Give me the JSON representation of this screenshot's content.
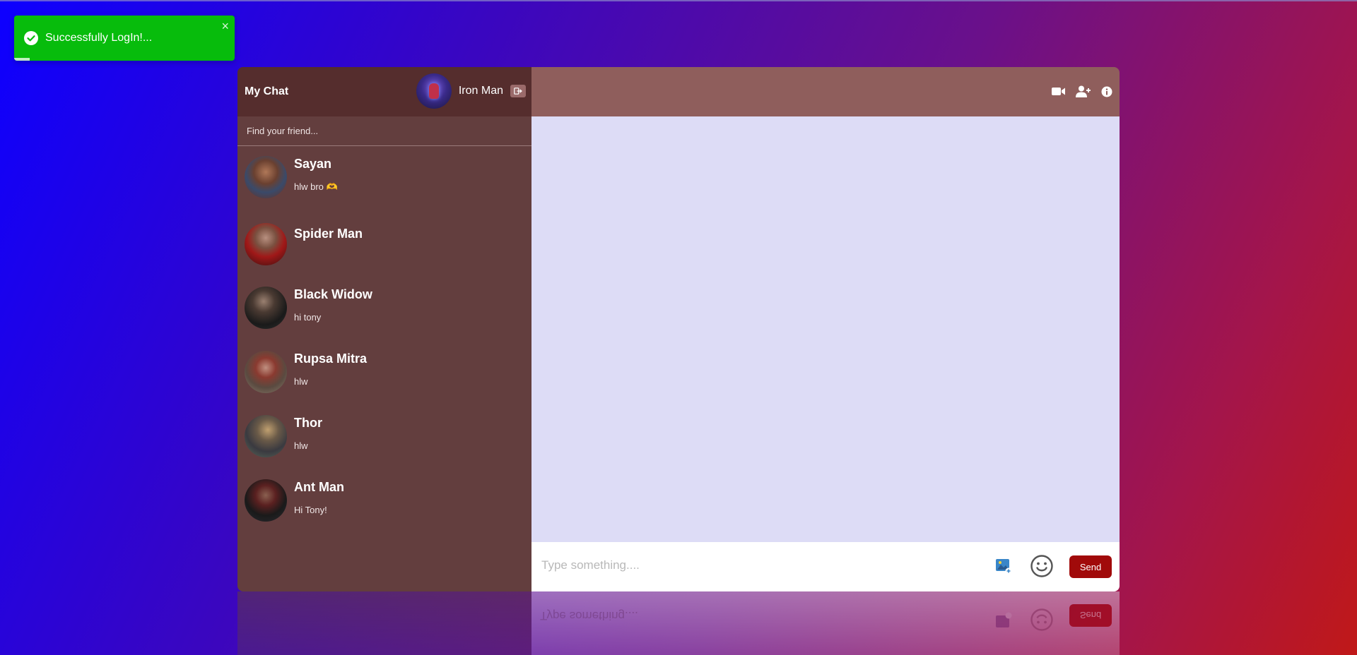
{
  "toast": {
    "message": "Successfully LogIn!...",
    "close_glyph": "×",
    "progress_percent": 7
  },
  "sidebar": {
    "brand": "My Chat",
    "current_user": {
      "name": "Iron Man",
      "avatar_icon": "iron-man-avatar"
    },
    "logout_icon": "logout-icon",
    "search": {
      "placeholder": "Find your friend...",
      "value": ""
    },
    "friends": [
      {
        "name": "Sayan",
        "last_message": "hlw bro 🫶"
      },
      {
        "name": "Spider Man",
        "last_message": ""
      },
      {
        "name": "Black Widow",
        "last_message": "hi tony"
      },
      {
        "name": "Rupsa Mitra",
        "last_message": "hlw"
      },
      {
        "name": "Thor",
        "last_message": "hlw"
      },
      {
        "name": "Ant Man",
        "last_message": "Hi Tony!"
      }
    ]
  },
  "header": {
    "icons": [
      "video-camera-icon",
      "add-user-icon",
      "info-icon"
    ]
  },
  "composer": {
    "placeholder": "Type something....",
    "value": "",
    "send_label": "Send",
    "reflection_send_label": "Send",
    "reflection_placeholder": "Type something...."
  },
  "colors": {
    "toast_bg": "#07bc0c",
    "sidebar_bg": "#633e3e",
    "sidebar_header_bg": "#552d2d",
    "chat_header_bg": "#8f5e5c",
    "messages_bg": "#dddcf6",
    "send_button_bg": "#a10a0a"
  }
}
